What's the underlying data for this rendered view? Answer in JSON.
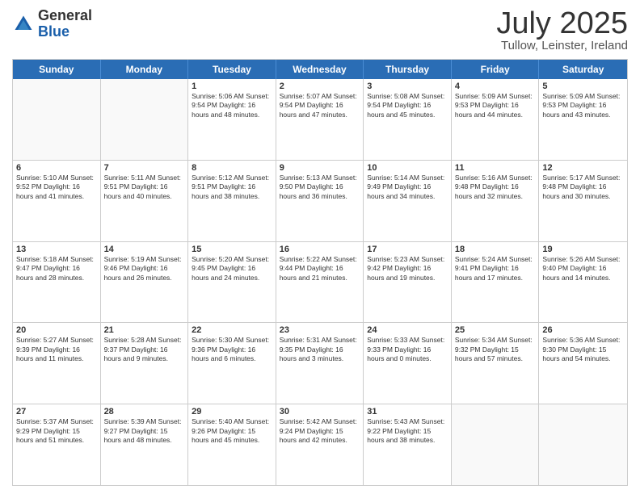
{
  "header": {
    "logo": {
      "general": "General",
      "blue": "Blue"
    },
    "title": "July 2025",
    "location": "Tullow, Leinster, Ireland"
  },
  "days": [
    "Sunday",
    "Monday",
    "Tuesday",
    "Wednesday",
    "Thursday",
    "Friday",
    "Saturday"
  ],
  "weeks": [
    [
      {
        "day": "",
        "info": ""
      },
      {
        "day": "",
        "info": ""
      },
      {
        "day": "1",
        "info": "Sunrise: 5:06 AM\nSunset: 9:54 PM\nDaylight: 16 hours and 48 minutes."
      },
      {
        "day": "2",
        "info": "Sunrise: 5:07 AM\nSunset: 9:54 PM\nDaylight: 16 hours and 47 minutes."
      },
      {
        "day": "3",
        "info": "Sunrise: 5:08 AM\nSunset: 9:54 PM\nDaylight: 16 hours and 45 minutes."
      },
      {
        "day": "4",
        "info": "Sunrise: 5:09 AM\nSunset: 9:53 PM\nDaylight: 16 hours and 44 minutes."
      },
      {
        "day": "5",
        "info": "Sunrise: 5:09 AM\nSunset: 9:53 PM\nDaylight: 16 hours and 43 minutes."
      }
    ],
    [
      {
        "day": "6",
        "info": "Sunrise: 5:10 AM\nSunset: 9:52 PM\nDaylight: 16 hours and 41 minutes."
      },
      {
        "day": "7",
        "info": "Sunrise: 5:11 AM\nSunset: 9:51 PM\nDaylight: 16 hours and 40 minutes."
      },
      {
        "day": "8",
        "info": "Sunrise: 5:12 AM\nSunset: 9:51 PM\nDaylight: 16 hours and 38 minutes."
      },
      {
        "day": "9",
        "info": "Sunrise: 5:13 AM\nSunset: 9:50 PM\nDaylight: 16 hours and 36 minutes."
      },
      {
        "day": "10",
        "info": "Sunrise: 5:14 AM\nSunset: 9:49 PM\nDaylight: 16 hours and 34 minutes."
      },
      {
        "day": "11",
        "info": "Sunrise: 5:16 AM\nSunset: 9:48 PM\nDaylight: 16 hours and 32 minutes."
      },
      {
        "day": "12",
        "info": "Sunrise: 5:17 AM\nSunset: 9:48 PM\nDaylight: 16 hours and 30 minutes."
      }
    ],
    [
      {
        "day": "13",
        "info": "Sunrise: 5:18 AM\nSunset: 9:47 PM\nDaylight: 16 hours and 28 minutes."
      },
      {
        "day": "14",
        "info": "Sunrise: 5:19 AM\nSunset: 9:46 PM\nDaylight: 16 hours and 26 minutes."
      },
      {
        "day": "15",
        "info": "Sunrise: 5:20 AM\nSunset: 9:45 PM\nDaylight: 16 hours and 24 minutes."
      },
      {
        "day": "16",
        "info": "Sunrise: 5:22 AM\nSunset: 9:44 PM\nDaylight: 16 hours and 21 minutes."
      },
      {
        "day": "17",
        "info": "Sunrise: 5:23 AM\nSunset: 9:42 PM\nDaylight: 16 hours and 19 minutes."
      },
      {
        "day": "18",
        "info": "Sunrise: 5:24 AM\nSunset: 9:41 PM\nDaylight: 16 hours and 17 minutes."
      },
      {
        "day": "19",
        "info": "Sunrise: 5:26 AM\nSunset: 9:40 PM\nDaylight: 16 hours and 14 minutes."
      }
    ],
    [
      {
        "day": "20",
        "info": "Sunrise: 5:27 AM\nSunset: 9:39 PM\nDaylight: 16 hours and 11 minutes."
      },
      {
        "day": "21",
        "info": "Sunrise: 5:28 AM\nSunset: 9:37 PM\nDaylight: 16 hours and 9 minutes."
      },
      {
        "day": "22",
        "info": "Sunrise: 5:30 AM\nSunset: 9:36 PM\nDaylight: 16 hours and 6 minutes."
      },
      {
        "day": "23",
        "info": "Sunrise: 5:31 AM\nSunset: 9:35 PM\nDaylight: 16 hours and 3 minutes."
      },
      {
        "day": "24",
        "info": "Sunrise: 5:33 AM\nSunset: 9:33 PM\nDaylight: 16 hours and 0 minutes."
      },
      {
        "day": "25",
        "info": "Sunrise: 5:34 AM\nSunset: 9:32 PM\nDaylight: 15 hours and 57 minutes."
      },
      {
        "day": "26",
        "info": "Sunrise: 5:36 AM\nSunset: 9:30 PM\nDaylight: 15 hours and 54 minutes."
      }
    ],
    [
      {
        "day": "27",
        "info": "Sunrise: 5:37 AM\nSunset: 9:29 PM\nDaylight: 15 hours and 51 minutes."
      },
      {
        "day": "28",
        "info": "Sunrise: 5:39 AM\nSunset: 9:27 PM\nDaylight: 15 hours and 48 minutes."
      },
      {
        "day": "29",
        "info": "Sunrise: 5:40 AM\nSunset: 9:26 PM\nDaylight: 15 hours and 45 minutes."
      },
      {
        "day": "30",
        "info": "Sunrise: 5:42 AM\nSunset: 9:24 PM\nDaylight: 15 hours and 42 minutes."
      },
      {
        "day": "31",
        "info": "Sunrise: 5:43 AM\nSunset: 9:22 PM\nDaylight: 15 hours and 38 minutes."
      },
      {
        "day": "",
        "info": ""
      },
      {
        "day": "",
        "info": ""
      }
    ]
  ]
}
